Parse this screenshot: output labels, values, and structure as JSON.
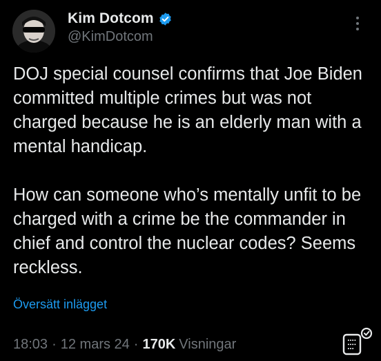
{
  "author": {
    "display_name": "Kim Dotcom",
    "handle": "@KimDotcom",
    "verified_color": "#1d9bf0"
  },
  "tweet": {
    "paragraphs": [
      "DOJ special counsel confirms that Joe Biden committed multiple crimes but was not charged because he is an elderly man with a mental handicap.",
      "How can someone who’s mentally unfit to be charged with a crime be the commander in chief and control the nuclear codes? Seems reckless."
    ],
    "translate_label": "Översätt inlägget"
  },
  "meta": {
    "time": "18:03",
    "date": "12 mars 24",
    "separator": "·",
    "views_count": "170K",
    "views_label": "Visningar"
  },
  "icons": {
    "avatar": "profile-photo",
    "verified": "verified-badge-icon",
    "more": "more-options-icon",
    "analytics": "post-analytics-icon"
  },
  "colors": {
    "background": "#000000",
    "text": "#e7e9ea",
    "secondary": "#71767b",
    "link": "#1d9bf0"
  }
}
